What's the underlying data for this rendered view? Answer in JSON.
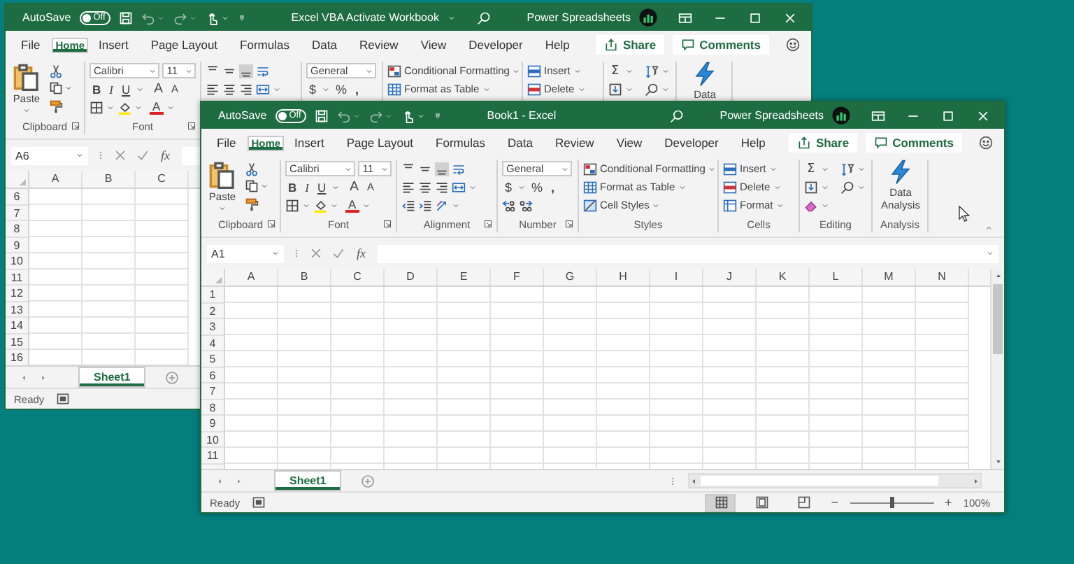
{
  "windows": [
    {
      "kind": "inactive",
      "title_bar": {
        "autosave": "AutoSave",
        "toggle": {
          "text": "Off",
          "on": false
        },
        "title": "Excel VBA Activate Workbook",
        "title_dropdown": true,
        "account": "Power Spreadsheets"
      },
      "tabs": [
        {
          "label": "File",
          "selected": false
        },
        {
          "label": "Home",
          "selected": true
        },
        {
          "label": "Insert",
          "selected": false
        },
        {
          "label": "Page Layout",
          "selected": false
        },
        {
          "label": "Formulas",
          "selected": false
        },
        {
          "label": "Data",
          "selected": false
        },
        {
          "label": "Review",
          "selected": false
        },
        {
          "label": "View",
          "selected": false
        },
        {
          "label": "Developer",
          "selected": false
        },
        {
          "label": "Help",
          "selected": false
        }
      ],
      "share": "Share",
      "comments": "Comments",
      "ribbon": [
        {
          "kind": "clipboard",
          "paste": "Paste",
          "label": "Clipboard"
        },
        {
          "kind": "font",
          "font_name": "Calibri",
          "font_size": "11",
          "styles": [
            "B",
            "I",
            "U"
          ],
          "grow": "A",
          "shrink": "A",
          "font_color": "A",
          "label": "Font"
        },
        {
          "kind": "alignment"
        },
        {
          "kind": "number",
          "format": "General",
          "currency": "$",
          "percent": "%",
          "comma": ","
        },
        {
          "kind": "styles",
          "buttons": [
            "Conditional Formatting",
            "Format as Table"
          ]
        },
        {
          "kind": "cells",
          "buttons": [
            "Insert",
            "Delete"
          ]
        },
        {
          "kind": "editing",
          "sum": "Σ"
        },
        {
          "kind": "analysis",
          "button": "Data"
        }
      ],
      "name_box": "A6",
      "function": "fx",
      "columns": [
        "A",
        "B",
        "C"
      ],
      "rows": [
        "6",
        "7",
        "8",
        "9",
        "10",
        "11",
        "12",
        "13",
        "14",
        "15",
        "16"
      ],
      "sheets": [
        {
          "label": "Sheet1",
          "selected": true
        }
      ],
      "status": "Ready"
    },
    {
      "kind": "active",
      "title_bar": {
        "autosave": "AutoSave",
        "toggle": {
          "text": "Off",
          "on": false
        },
        "title": "Book1 - Excel",
        "title_dropdown": false,
        "account": "Power Spreadsheets"
      },
      "tabs": [
        {
          "label": "File",
          "selected": false
        },
        {
          "label": "Home",
          "selected": true
        },
        {
          "label": "Insert",
          "selected": false
        },
        {
          "label": "Page Layout",
          "selected": false
        },
        {
          "label": "Formulas",
          "selected": false
        },
        {
          "label": "Data",
          "selected": false
        },
        {
          "label": "Review",
          "selected": false
        },
        {
          "label": "View",
          "selected": false
        },
        {
          "label": "Developer",
          "selected": false
        },
        {
          "label": "Help",
          "selected": false
        }
      ],
      "share": "Share",
      "comments": "Comments",
      "ribbon": [
        {
          "kind": "clipboard",
          "paste": "Paste",
          "label": "Clipboard"
        },
        {
          "kind": "font",
          "font_name": "Calibri",
          "font_size": "11",
          "styles": [
            "B",
            "I",
            "U"
          ],
          "grow": "A",
          "shrink": "A",
          "font_color": "A",
          "label": "Font"
        },
        {
          "kind": "alignment",
          "label": "Alignment"
        },
        {
          "kind": "number",
          "format": "General",
          "currency": "$",
          "percent": "%",
          "comma": ",",
          "label": "Number"
        },
        {
          "kind": "styles",
          "buttons": [
            "Conditional Formatting",
            "Format as Table",
            "Cell Styles"
          ],
          "label": "Styles"
        },
        {
          "kind": "cells",
          "buttons": [
            "Insert",
            "Delete",
            "Format"
          ],
          "label": "Cells"
        },
        {
          "kind": "editing",
          "sum": "Σ",
          "label": "Editing"
        },
        {
          "kind": "analysis",
          "button": "Data Analysis",
          "label": "Analysis"
        }
      ],
      "name_box": "A1",
      "function": "fx",
      "columns": [
        "A",
        "B",
        "C",
        "D",
        "E",
        "F",
        "G",
        "H",
        "I",
        "J",
        "K",
        "L",
        "M",
        "N"
      ],
      "rows": [
        "1",
        "2",
        "3",
        "4",
        "5",
        "6",
        "7",
        "8",
        "9",
        "10",
        "11"
      ],
      "sheets": [
        {
          "label": "Sheet1",
          "selected": true
        }
      ],
      "status": "Ready",
      "views": [
        {
          "selected": true
        },
        {
          "selected": false
        },
        {
          "selected": false
        }
      ],
      "zoom": {
        "out": "−",
        "level": 0.5,
        "in": "+",
        "percent": "100%"
      }
    }
  ]
}
